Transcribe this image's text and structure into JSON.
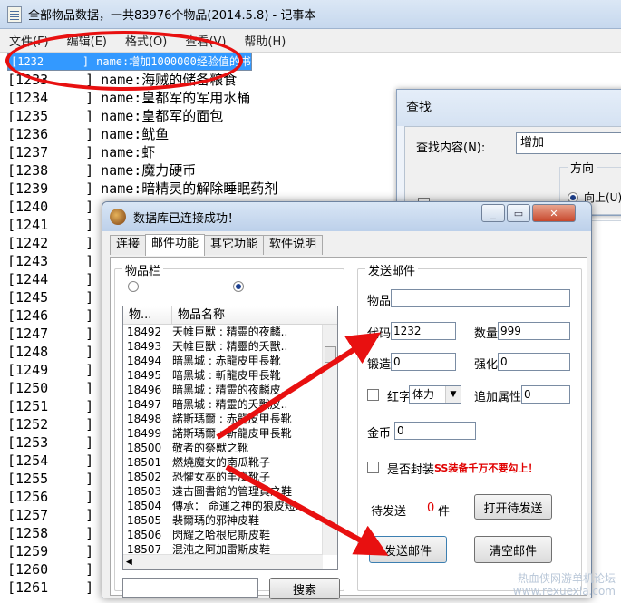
{
  "notepad": {
    "title": "全部物品数据，一共83976个物品(2014.5.8) - 记事本",
    "menu": [
      "文件(F)",
      "编辑(E)",
      "格式(O)",
      "查看(V)",
      "帮助(H)"
    ],
    "lines": [
      {
        "code": "[1232",
        "name": "name:增加1000000经验值的书",
        "selected": true
      },
      {
        "code": "[1233",
        "name": "name:海贼的储备粮食"
      },
      {
        "code": "[1234",
        "name": "name:皇都军的军用水桶"
      },
      {
        "code": "[1235",
        "name": "name:皇都军的面包"
      },
      {
        "code": "[1236",
        "name": "name:鱿鱼"
      },
      {
        "code": "[1237",
        "name": "name:虾"
      },
      {
        "code": "[1238",
        "name": "name:魔力硬币"
      },
      {
        "code": "[1239",
        "name": "name:暗精灵的解除睡眠药剂"
      },
      {
        "code": "[1240",
        "name": ""
      },
      {
        "code": "[1241",
        "name": ""
      },
      {
        "code": "[1242",
        "name": ""
      },
      {
        "code": "[1243",
        "name": ""
      },
      {
        "code": "[1244",
        "name": ""
      },
      {
        "code": "[1245",
        "name": ""
      },
      {
        "code": "[1246",
        "name": ""
      },
      {
        "code": "[1247",
        "name": ""
      },
      {
        "code": "[1248",
        "name": ""
      },
      {
        "code": "[1249",
        "name": ""
      },
      {
        "code": "[1250",
        "name": ""
      },
      {
        "code": "[1251",
        "name": ""
      },
      {
        "code": "[1252",
        "name": ""
      },
      {
        "code": "[1253",
        "name": ""
      },
      {
        "code": "[1254",
        "name": ""
      },
      {
        "code": "[1255",
        "name": ""
      },
      {
        "code": "[1256",
        "name": ""
      },
      {
        "code": "[1257",
        "name": ""
      },
      {
        "code": "[1258",
        "name": ""
      },
      {
        "code": "[1259",
        "name": ""
      },
      {
        "code": "[1260",
        "name": ""
      },
      {
        "code": "[1261",
        "name": ""
      }
    ]
  },
  "find": {
    "title": "查找",
    "label": "查找内容(N):",
    "value": "增加",
    "direction_label": "方向",
    "up_label": "向上(U)"
  },
  "db": {
    "title": "数据库已连接成功！",
    "tabs": [
      "连接",
      "邮件功能",
      "其它功能",
      "软件说明"
    ],
    "items_group": "物品栏",
    "col_id": "物...",
    "col_name": "物品名称",
    "items": [
      [
        "18492",
        "天帷巨獸 : 精靈的夜麟.."
      ],
      [
        "18493",
        "天帷巨獸 : 精靈的夭獸.."
      ],
      [
        "18494",
        "暗黑城 : 赤龍皮甲長靴"
      ],
      [
        "18495",
        "暗黑城 : 斬龍皮甲長靴"
      ],
      [
        "18496",
        "暗黑城 : 精靈的夜麟皮.."
      ],
      [
        "18497",
        "暗黑城 : 精靈的夭獸皮.."
      ],
      [
        "18498",
        "諾斯瑪爾 : 赤龍皮甲長靴"
      ],
      [
        "18499",
        "諾斯瑪爾 : 斬龍皮甲長靴"
      ],
      [
        "18500",
        "敬者的祭獸之靴"
      ],
      [
        "18501",
        "燃燒魔女的南瓜靴子"
      ],
      [
        "18502",
        "恐懼女巫的羊皮靴子"
      ],
      [
        "18503",
        "遠古圖書館的管理員之鞋"
      ],
      [
        "18504",
        "傳承： 命運之神的狼皮短.."
      ],
      [
        "18505",
        "裴爾瑪的邪神皮鞋"
      ],
      [
        "18506",
        "閃耀之哈根尼斯皮鞋"
      ],
      [
        "18507",
        "混沌之阿加雷斯皮鞋"
      ]
    ],
    "search_button": "搜索",
    "mail_group": "发送邮件",
    "item_label": "物品",
    "code_label": "代码",
    "code_value": "1232",
    "qty_label": "数量",
    "qty_value": "999",
    "forge_label": "锻造",
    "forge_value": "0",
    "enhance_label": "强化",
    "enhance_value": "0",
    "red_label": "红字",
    "red_select": "体力",
    "extra_label": "追加属性",
    "extra_value": "0",
    "gold_label": "金币",
    "gold_value": "0",
    "seal_label": "是否封装",
    "warning": "SS装备千万不要勾上！",
    "pending_label": "待发送",
    "pending_count": "0",
    "pending_unit": "件",
    "open_pending": "打开待发送",
    "send": "发送邮件",
    "clear": "清空邮件"
  },
  "watermark": {
    "line1": "热血侠网游单机论坛",
    "line2": "www.rexuexia.com"
  },
  "colors": {
    "highlight": "#3399ff",
    "annotation": "#e81010",
    "warning": "#e00000"
  }
}
